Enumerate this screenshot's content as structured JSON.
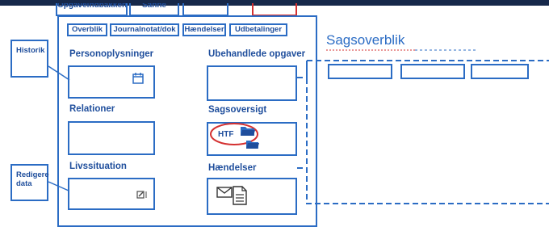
{
  "top_cut_tabs": [
    {
      "label": "Opgaveindbakken"
    },
    {
      "label": "Sanne"
    },
    {
      "label": ""
    },
    {
      "label": ""
    }
  ],
  "tabs": [
    {
      "label": "Overblik"
    },
    {
      "label": "Journalnotat/dok"
    },
    {
      "label": "Hændelser"
    },
    {
      "label": "Udbetalinger"
    }
  ],
  "sections": {
    "personoplysninger": "Personoplysninger",
    "relationer": "Relationer",
    "livssituation": "Livssituation",
    "ubehandlede": "Ubehandlede opgaver",
    "sagsoversigt": "Sagsoversigt",
    "haendelser": "Hændelser"
  },
  "notes": {
    "historik": "Historik",
    "redigere": "Redigere data"
  },
  "sagsoverblik_title": "Sagsoverblik",
  "htf_label": "HTF",
  "icons": {
    "calendar": "calendar-icon",
    "edit": "edit-icon",
    "folder": "folder-icon",
    "envelope": "envelope-icon",
    "document": "document-icon"
  },
  "colors": {
    "accent_blue": "#2b6cc4",
    "text_blue": "#1f4e9c",
    "highlight_red": "#d43030",
    "topbar": "#16284a"
  }
}
